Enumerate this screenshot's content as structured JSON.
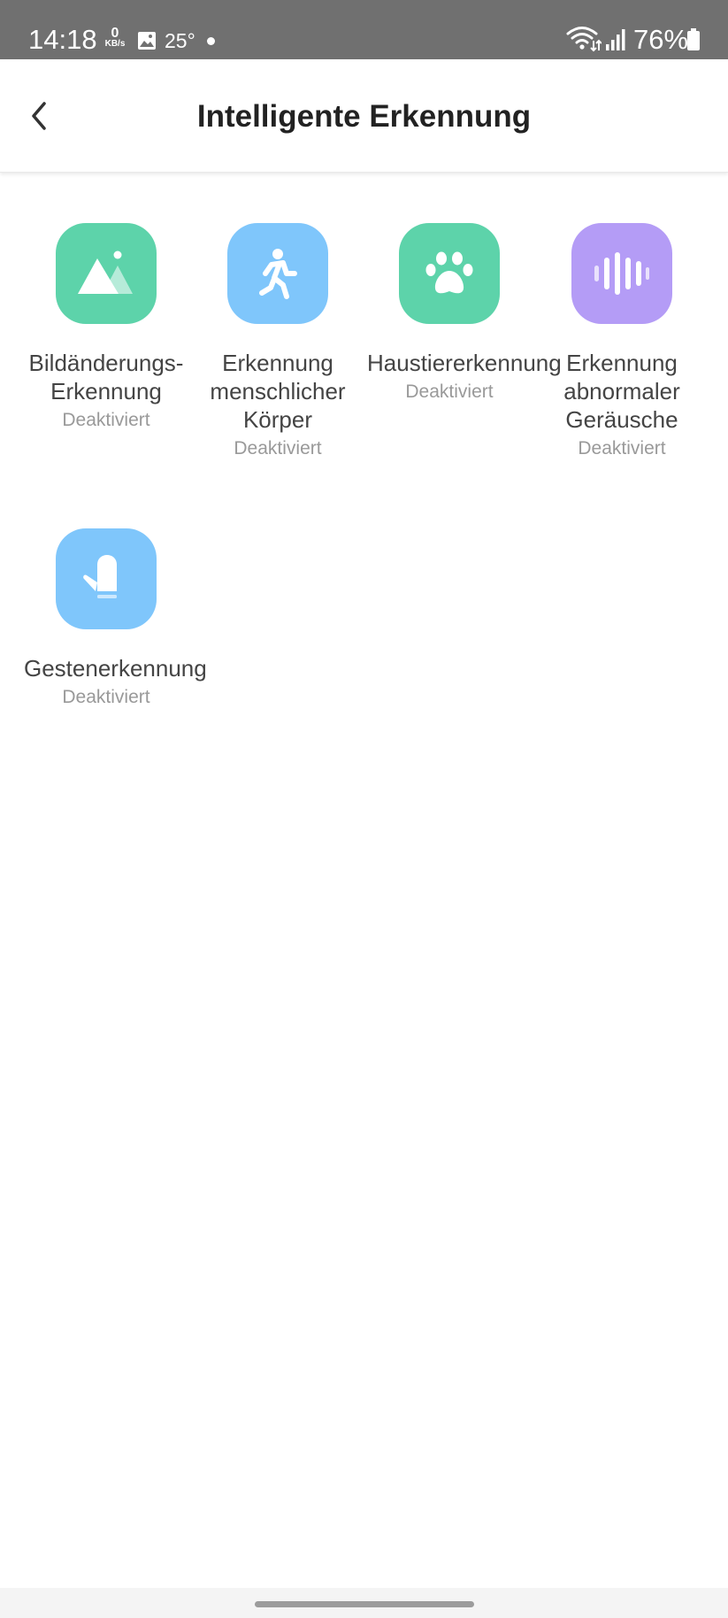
{
  "status_bar": {
    "time": "14:18",
    "net_speed_value": "0",
    "net_speed_unit": "KB/s",
    "temperature": "25°",
    "battery": "76%",
    "icons": [
      "gallery-icon",
      "dot-icon",
      "wifi-icon",
      "signal-icon",
      "battery-icon"
    ]
  },
  "header": {
    "title": "Intelligente Erkennung",
    "back_icon": "chevron-left-icon"
  },
  "features": [
    {
      "label": "Bildänderungs-Erkennung",
      "status": "Deaktiviert",
      "icon": "image-landscape-icon",
      "color": "#5dd3aa"
    },
    {
      "label": "Erkennung menschlicher Körper",
      "status": "Deaktiviert",
      "icon": "running-person-icon",
      "color": "#7fc6fb"
    },
    {
      "label": "Haustiererkennung",
      "status": "Deaktiviert",
      "icon": "paw-icon",
      "color": "#5dd3aa"
    },
    {
      "label": "Erkennung abnormaler Geräusche",
      "status": "Deaktiviert",
      "icon": "sound-wave-icon",
      "color": "#b49cf6"
    },
    {
      "label": "Gestenerkennung",
      "status": "Deaktiviert",
      "icon": "hand-gesture-icon",
      "color": "#7fc6fb"
    }
  ],
  "colors": {
    "status_bar": "#707070",
    "title_text": "#222222",
    "label_text": "#444444",
    "status_text": "#999999"
  }
}
